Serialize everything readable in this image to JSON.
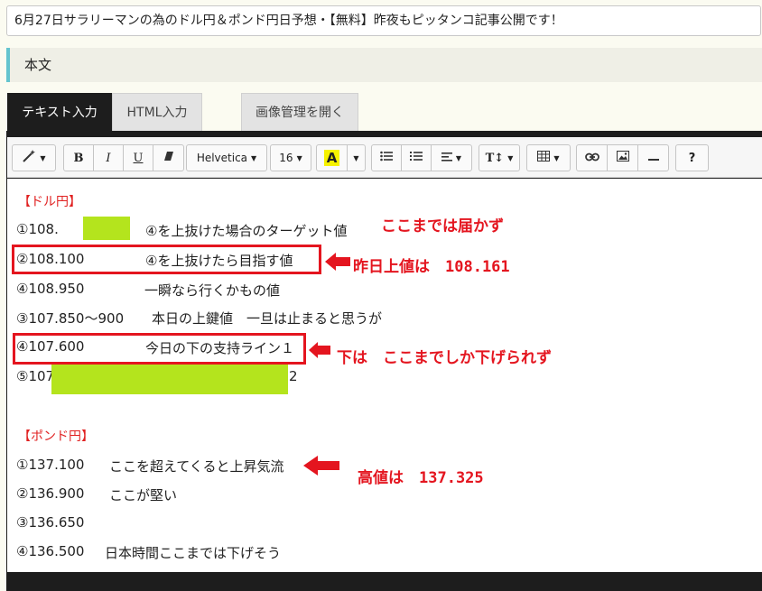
{
  "post_title": "6月27日サラリーマンの為のドル円＆ポンド円日予想・【無料】昨夜もピッタンコ記事公開です！",
  "section_title": "本文",
  "tabs": {
    "text_input": "テキスト入力",
    "html_input": "HTML入力",
    "image_manager": "画像管理を開く"
  },
  "toolbar": {
    "magic_icon": "wand-icon",
    "bold": "B",
    "italic": "I",
    "underline": "U",
    "font_family": "Helvetica",
    "font_size": "16",
    "font_color": "A",
    "line_height": "T↕",
    "help": "?",
    "colors": {
      "font_color_highlight": "#f6f200"
    }
  },
  "content": {
    "dollar_heading": "【ドル円】",
    "dollar_lines": [
      {
        "price": "①108.",
        "desc": "④を上抜けた場合のターゲット値"
      },
      {
        "price": "②108.100",
        "desc": "④を上抜けたら目指す値"
      },
      {
        "price": "④108.950",
        "desc": "一瞬なら行くかもの値"
      },
      {
        "price": "③107.850～900",
        "desc": "本日の上鍵値　一旦は止まると思うが"
      },
      {
        "price": "④107.600",
        "desc": "今日の下の支持ライン１"
      },
      {
        "price": "⑤107",
        "desc": "2"
      }
    ],
    "pound_heading": "【ポンド円】",
    "pound_lines": [
      {
        "price": "①137.100",
        "desc": "ここを超えてくると上昇気流"
      },
      {
        "price": "②136.900",
        "desc": "ここが堅い"
      },
      {
        "price": "③136.650",
        "desc": ""
      },
      {
        "price": "④136.500",
        "desc": "日本時間ここまでは下げそう"
      }
    ]
  },
  "annotations": {
    "not_reached": "ここまでは届かず",
    "yesterday_high": "昨日上値は　108.161",
    "lower_limit": "下は　ここまでしか下げられず",
    "high_value": "高値は　137.325"
  },
  "colors": {
    "annotation_red": "#e4151f",
    "mask_green": "#b4e41d",
    "accent_teal": "#64c4cf"
  }
}
